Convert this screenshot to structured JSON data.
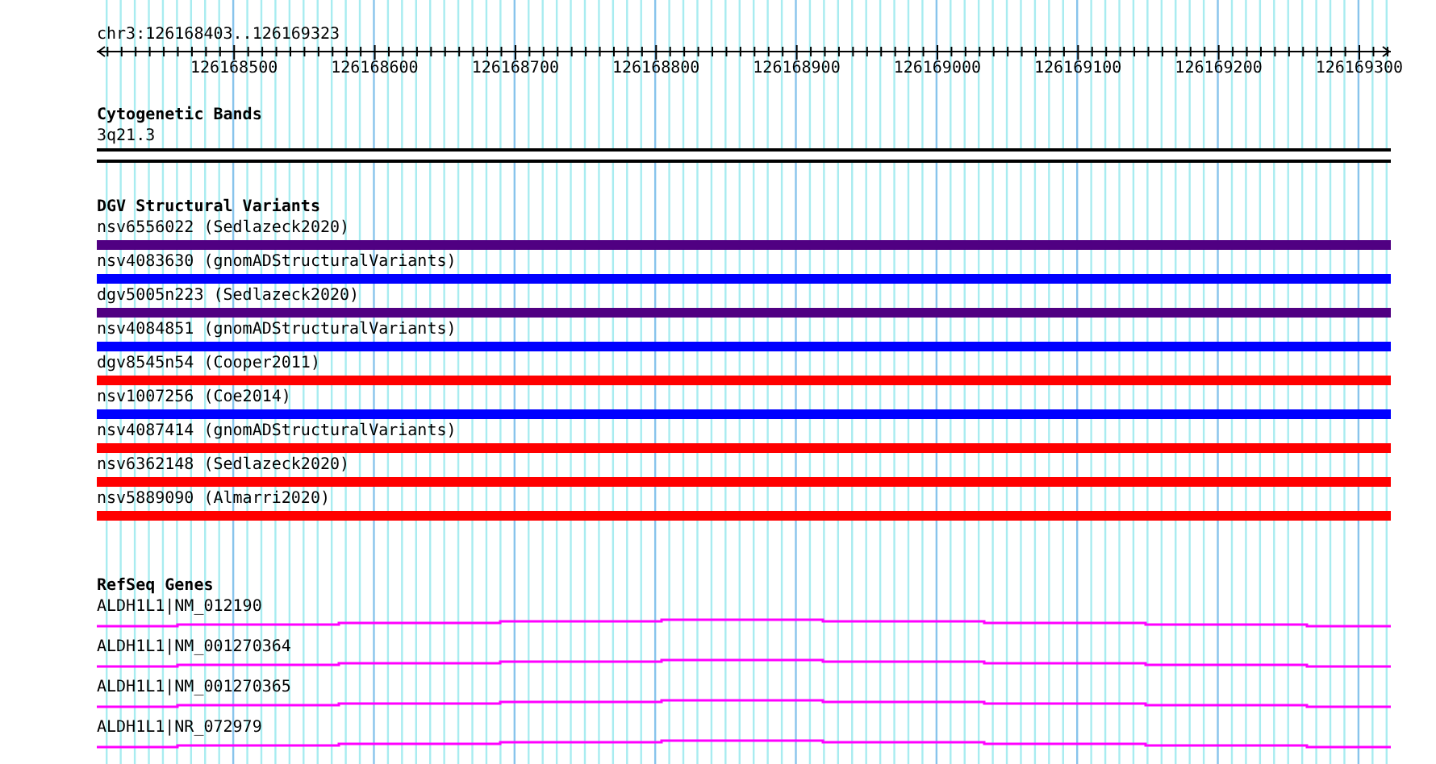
{
  "locus": "chr3:126168403..126169323",
  "ruler": {
    "labels": [
      "126168500",
      "126168600",
      "126168700",
      "126168800",
      "126168900",
      "126169000",
      "126169100",
      "126169200",
      "126169300"
    ]
  },
  "tracks": [
    {
      "kind": "bands",
      "title": "Cytogenetic Bands",
      "items": [
        {
          "label": "3q21.3"
        }
      ]
    },
    {
      "kind": "variants",
      "title": "DGV Structural Variants",
      "items": [
        {
          "label": "nsv6556022 (Sedlazeck2020)",
          "color": "#500082"
        },
        {
          "label": "nsv4083630 (gnomADStructuralVariants)",
          "color": "#0000ff"
        },
        {
          "label": "dgv5005n223 (Sedlazeck2020)",
          "color": "#500082"
        },
        {
          "label": "nsv4084851 (gnomADStructuralVariants)",
          "color": "#0000ff"
        },
        {
          "label": "dgv8545n54 (Cooper2011)",
          "color": "#ff0000"
        },
        {
          "label": "nsv1007256 (Coe2014)",
          "color": "#0000ff"
        },
        {
          "label": "nsv4087414 (gnomADStructuralVariants)",
          "color": "#ff0000"
        },
        {
          "label": "nsv6362148 (Sedlazeck2020)",
          "color": "#ff0000"
        },
        {
          "label": "nsv5889090 (Almarri2020)",
          "color": "#ff0000"
        }
      ]
    },
    {
      "kind": "genes",
      "title": "RefSeq Genes",
      "items": [
        {
          "label": "ALDH1L1|NM_012190"
        },
        {
          "label": "ALDH1L1|NM_001270364"
        },
        {
          "label": "ALDH1L1|NM_001270365"
        },
        {
          "label": "ALDH1L1|NR_072979"
        }
      ]
    }
  ]
}
